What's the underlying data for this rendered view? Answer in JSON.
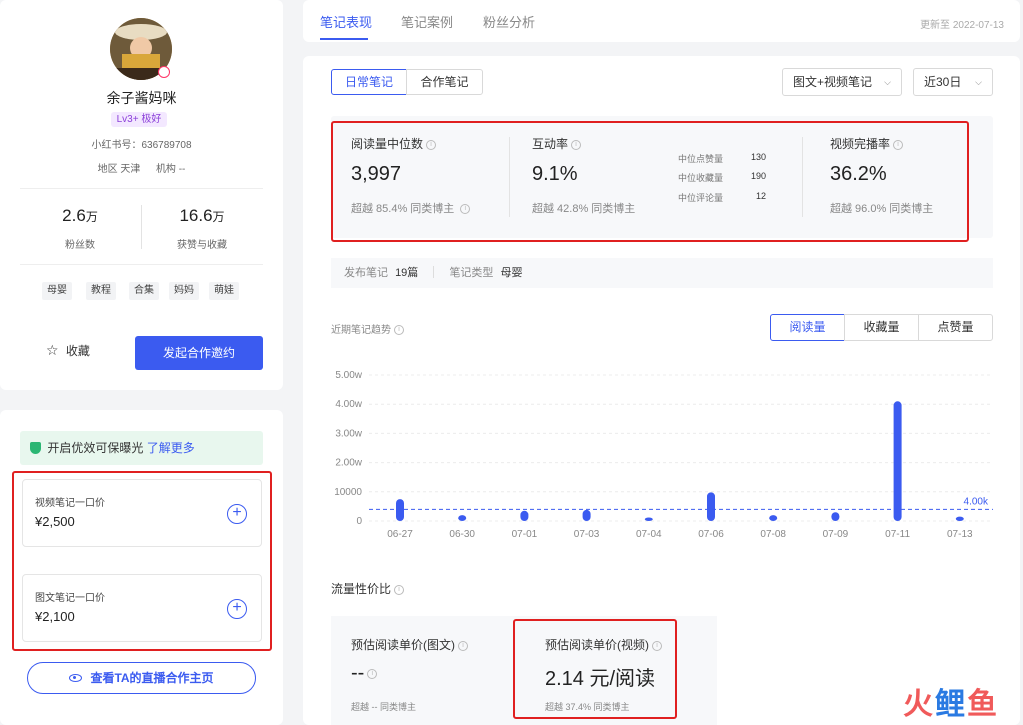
{
  "profile": {
    "name": "余子酱妈咪",
    "level": "Lv3+ 极好",
    "xhs_id": "小红书号：636789708",
    "region_label": "地区",
    "region": "天津",
    "org_label": "机构",
    "org": "--",
    "stats": [
      {
        "value": "2.6",
        "unit": "万",
        "label": "粉丝数"
      },
      {
        "value": "16.6",
        "unit": "万",
        "label": "获赞与收藏"
      }
    ],
    "tags": [
      "母婴",
      "教程",
      "合集",
      "妈妈",
      "萌娃"
    ],
    "fav_label": "收藏",
    "invite_label": "发起合作邀约"
  },
  "pricing": {
    "notice_text": "开启优效可保曝光",
    "notice_link": "了解更多",
    "cards": [
      {
        "label": "视频笔记一口价",
        "value": "¥2,500"
      },
      {
        "label": "图文笔记一口价",
        "value": "¥2,100"
      }
    ],
    "live_label": "查看TA的直播合作主页"
  },
  "tabs": [
    {
      "label": "笔记表现"
    },
    {
      "label": "笔记案例"
    },
    {
      "label": "粉丝分析"
    }
  ],
  "updated": "更新至 2022-07-13",
  "note_types": [
    "日常笔记",
    "合作笔记"
  ],
  "selects": {
    "content": "图文+视频笔记",
    "period": "近30日"
  },
  "metrics": {
    "read_median": {
      "title": "阅读量中位数",
      "value": "3,997",
      "sub": "超越 85.4% 同类博主"
    },
    "interaction": {
      "title": "互动率",
      "value": "9.1%",
      "sub": "超越 42.8% 同类博主"
    },
    "mini": [
      {
        "label": "中位点赞量",
        "value": "130"
      },
      {
        "label": "中位收藏量",
        "value": "190"
      },
      {
        "label": "中位评论量",
        "value": "12"
      }
    ],
    "completion": {
      "title": "视频完播率",
      "value": "36.2%",
      "sub": "超越 96.0% 同类博主"
    }
  },
  "publish": {
    "count_label": "发布笔记",
    "count": "19篇",
    "type_label": "笔记类型",
    "type": "母婴"
  },
  "trend": {
    "label": "近期笔记趋势",
    "metric_tabs": [
      "阅读量",
      "收藏量",
      "点赞量"
    ]
  },
  "chart_data": {
    "type": "bar",
    "categories": [
      "06-27",
      "06-30",
      "07-01",
      "07-03",
      "07-04",
      "07-06",
      "07-08",
      "07-09",
      "07-11",
      "07-13"
    ],
    "values": [
      7500,
      2000,
      3500,
      3800,
      1200,
      9800,
      2000,
      3000,
      41000,
      1500
    ],
    "y_ticks": [
      "0",
      "10000",
      "2.00w",
      "3.00w",
      "4.00w",
      "5.00w"
    ],
    "ylim": [
      0,
      50000
    ],
    "reference_line": {
      "value": 4000,
      "label": "4.00k"
    },
    "color": "#3b5bf0",
    "grid": true
  },
  "cost": {
    "title": "流量性价比",
    "graphic": {
      "title": "预估阅读单价(图文)",
      "value": "--",
      "sub": "超越 -- 同类博主"
    },
    "video": {
      "title": "预估阅读单价(视频)",
      "value": "2.14 元/阅读",
      "sub": "超越 37.4% 同类博主"
    }
  },
  "watermark": {
    "chars": [
      "火",
      "鲤",
      "鱼"
    ],
    "colors": [
      "#f05a5a",
      "#2a7ae2",
      "#f05a5a"
    ]
  }
}
